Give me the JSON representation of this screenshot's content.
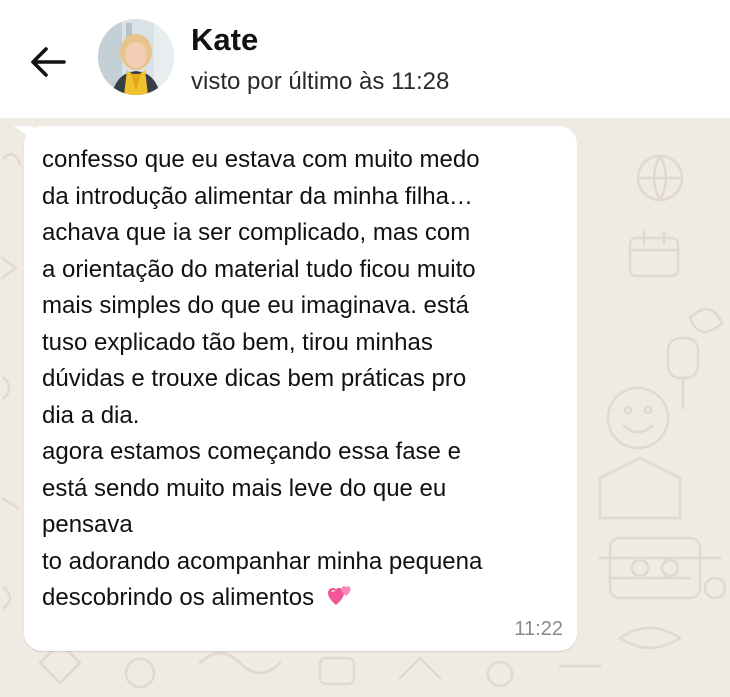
{
  "header": {
    "back_icon": "arrow-left-icon",
    "avatar_icon": "contact-avatar-photo",
    "contact_name": "Kate",
    "last_seen": "visto por último às 11:28"
  },
  "message": {
    "lines": [
      "confesso que eu estava com muito medo",
      "da introdução alimentar da minha filha…",
      "achava que ia ser complicado, mas com",
      "a orientação do material tudo ficou muito",
      "mais simples do que eu imaginava. está",
      "tuso explicado tão bem, tirou minhas",
      "dúvidas e trouxe dicas bem práticas pro",
      "dia a dia.",
      "agora estamos começando essa fase e",
      "está sendo muito mais leve do que eu",
      "pensava",
      "to adorando acompanhar minha pequena",
      "descobrindo os alimentos"
    ],
    "emoji_icon": "two-hearts-icon",
    "time": "11:22"
  },
  "colors": {
    "chat_background": "#efeae2",
    "bubble": "#ffffff",
    "timestamp": "#8a8a8a",
    "heart": "#f2559a"
  }
}
